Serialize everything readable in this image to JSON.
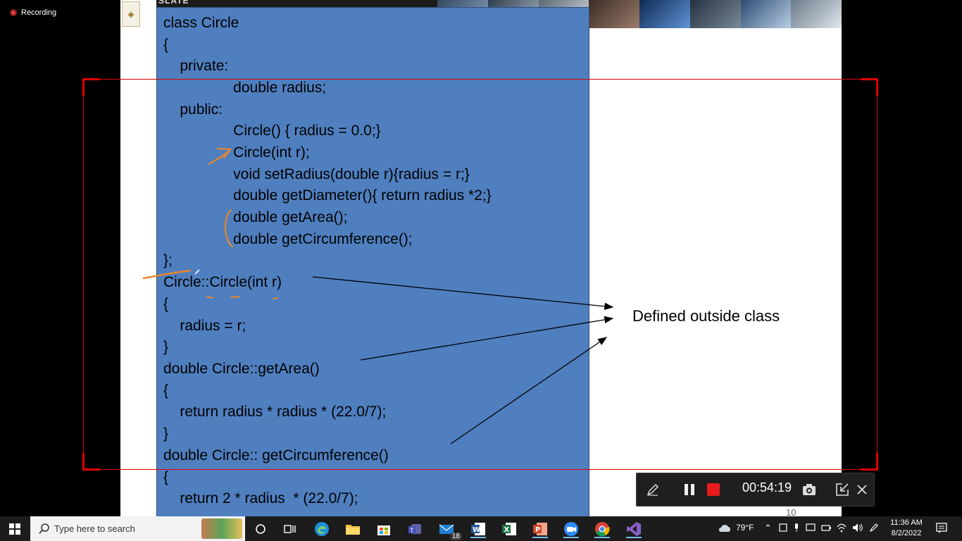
{
  "recording": {
    "label": "Recording"
  },
  "slide": {
    "top_text": "SLATE",
    "code_lines": [
      "class Circle",
      "{",
      "    private:",
      "                 double radius;",
      "    public:",
      "                 Circle() { radius = 0.0;}",
      "                 Circle(int r);",
      "                 void setRadius(double r){radius = r;}",
      "                 double getDiameter(){ return radius *2;}",
      "                 double getArea();",
      "                 double getCircumference();",
      "};",
      "Circle::Circle(int r)",
      "{",
      "    radius = r;",
      "}",
      "double Circle::getArea()",
      "{",
      "    return radius * radius * (22.0/7);",
      "}",
      "double Circle:: getCircumference()",
      "{",
      "    return 2 * radius  * (22.0/7);"
    ],
    "annotation": "Defined outside class",
    "page_number": "10"
  },
  "recorder_toolbar": {
    "timer": "00:54:19",
    "buttons": [
      "pen-icon",
      "pause-icon",
      "stop-icon",
      "camera-icon",
      "minimize-icon",
      "close-icon"
    ]
  },
  "taskbar": {
    "search_placeholder": "Type here to search",
    "apps": [
      "task-view",
      "edge",
      "file-explorer",
      "store",
      "teams",
      "mail",
      "word",
      "excel",
      "powerpoint",
      "zoom",
      "chrome",
      "visual-studio"
    ],
    "mail_badge": "18",
    "weather": "79°F",
    "time": "11:36 AM",
    "date": "8/2/2022"
  },
  "colors": {
    "code_box": "#4f7fbf",
    "rec_border": "#e00000",
    "annotation_orange": "#e8872a"
  }
}
